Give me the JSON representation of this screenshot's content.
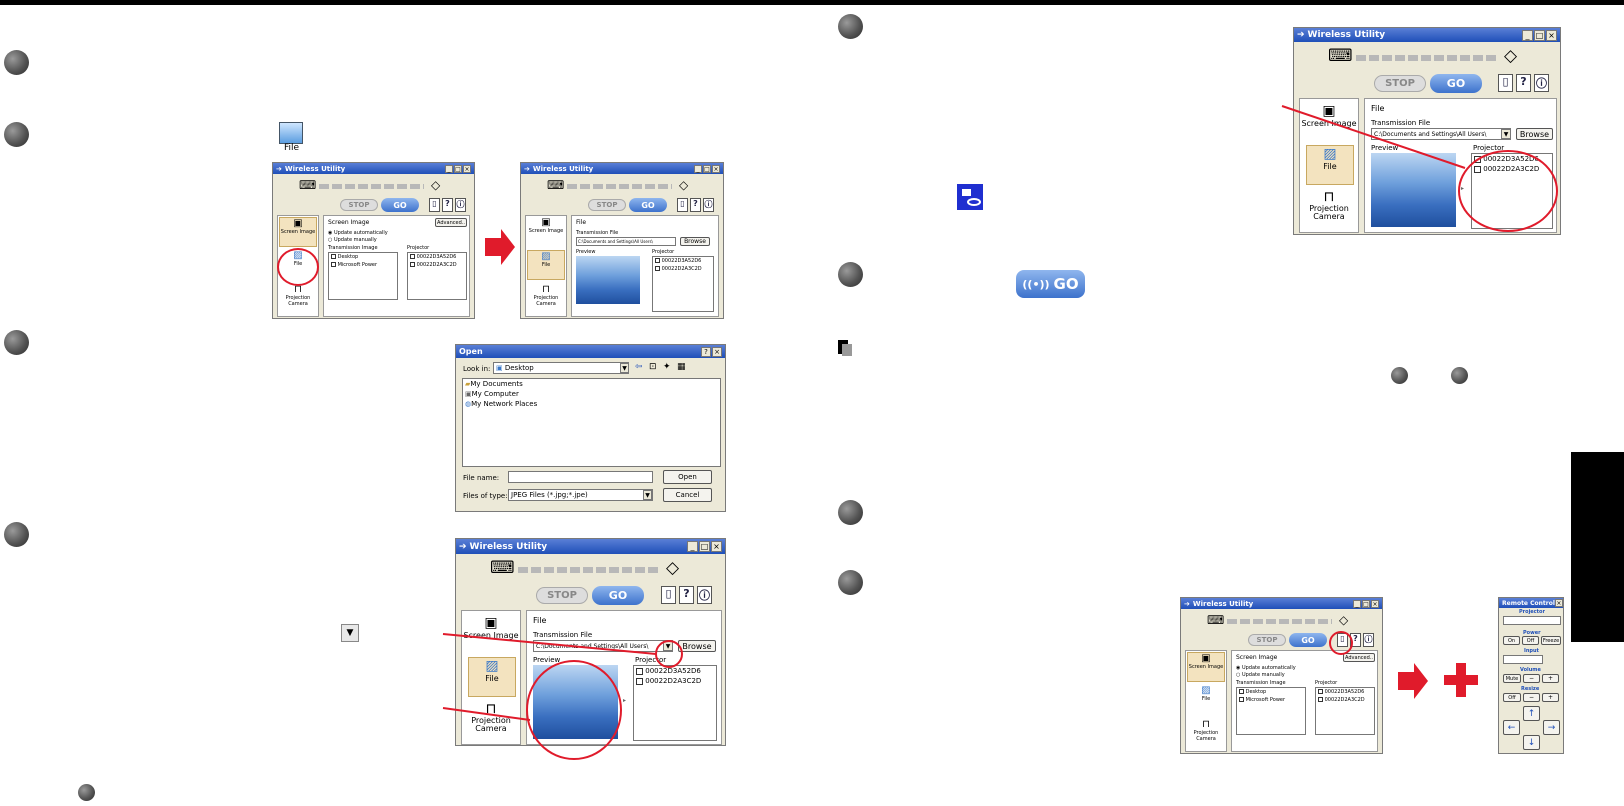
{
  "app": {
    "title": "Wireless Utility",
    "stop_label": "STOP",
    "go_label": "GO",
    "sidebar": [
      "Screen Image",
      "File",
      "Projection Camera"
    ],
    "screen_image_heading": "Screen Image",
    "advanced_label": "Advanced..",
    "update_auto": "Update automatically",
    "update_manual": "Update manually",
    "transmission_image_label": "Transmission Image",
    "image_list": [
      "Desktop",
      "Microsoft Power"
    ],
    "projector_label": "Projector",
    "projectors": [
      "00022D3A52D6",
      "00022D2A3C2D"
    ],
    "file_heading": "File",
    "transmission_file_label": "Transmission File",
    "transmission_file_value": "C:\\Documents and Settings\\All Users\\",
    "browse_label": "Browse",
    "preview_label": "Preview"
  },
  "file_icon_caption": "File",
  "open_dialog": {
    "title": "Open",
    "look_in_label": "Look in:",
    "look_in_value": "Desktop",
    "items": [
      "My Documents",
      "My Computer",
      "My Network Places"
    ],
    "file_name_label": "File name:",
    "files_of_type_label": "Files of type:",
    "files_of_type_value": "JPEG Files (*.jpg;*.jpe)",
    "open_button": "Open",
    "cancel_button": "Cancel"
  },
  "remote": {
    "title": "Remote Control",
    "projector_label": "Projector",
    "power_label": "Power",
    "on": "On",
    "off": "Off",
    "freeze": "Freeze",
    "input_label": "Input",
    "volume_label": "Volume",
    "mute": "Mute",
    "minus": "−",
    "plus": "+",
    "resize_label": "Resize",
    "resize_off": "Off"
  },
  "colors": {
    "accent_red": "#e01b2b",
    "title_blue": "#1f4fb8"
  }
}
